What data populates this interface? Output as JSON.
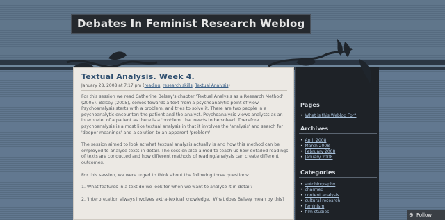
{
  "blog": {
    "title": "Debates In Feminist Research Weblog"
  },
  "post": {
    "title": "Textual Analysis. Week 4.",
    "meta_prefix": "January 28, 2008 at 7:17 pm (",
    "categories": [
      "reading",
      "research skills",
      "Textual Analysis"
    ],
    "meta_suffix": ")",
    "paragraphs": [
      "For this session we read Catherine Belsey's chapter 'Textual Analysis as a Research Method' (2005). Belsey (2005), comes towards a text from a psychoanalytic point of view. Psychoanalysis starts with a problem, and tries to solve it. There are two people in a psychoanalytic encounter: the patient and the analyst. Psychoanalysis views analysts as an interpreter of a patient as there is a 'problem' that needs to be solved. Therefore psychoanalysis is almost like textual analysis in that it involves the 'analysis' and search for 'deeper meanings' and a solution to an apparent 'problem'.",
      "The session aimed to look at what textual analysis actually is and how this method can be employed to analyse texts in detail. The session also aimed to teach us how detailed readings of texts are conducted and how different methods of reading/analysis can create different outcomes.",
      "For this session, we were urged to think about the following three questions:",
      "1. What features in a text do we look for when we want to analyse it in detail?",
      "2. 'Interpretation always involves extra-textual knowledge.' What does Belsey mean by this?"
    ]
  },
  "sidebar": {
    "pages": {
      "heading": "Pages",
      "items": [
        "What is this Weblog For?"
      ]
    },
    "archives": {
      "heading": "Archives",
      "items": [
        "April 2008",
        "March 2008",
        "February 2008",
        "January 2008"
      ]
    },
    "categories": {
      "heading": "Categories",
      "items": [
        "autobiography",
        "charmed",
        "content analysis",
        "cultural research",
        "feminism",
        "film studies"
      ]
    }
  },
  "follow": {
    "label": "Follow"
  },
  "colors": {
    "post_title": "#2f4f6f",
    "link": "#3a5f86",
    "sidebar_bg": "#1e2227",
    "header_bg": "#5d7287"
  }
}
